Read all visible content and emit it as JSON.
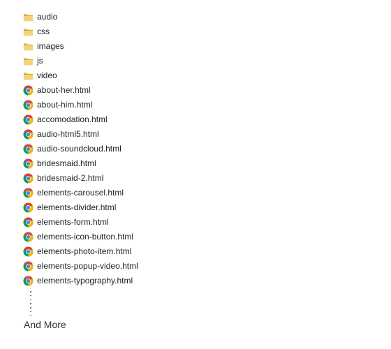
{
  "items": [
    {
      "name": "audio",
      "type": "folder",
      "icon": "folder-icon"
    },
    {
      "name": "css",
      "type": "folder",
      "icon": "folder-icon"
    },
    {
      "name": "images",
      "type": "folder",
      "icon": "folder-icon"
    },
    {
      "name": "js",
      "type": "folder",
      "icon": "folder-icon"
    },
    {
      "name": "video",
      "type": "folder",
      "icon": "folder-icon"
    },
    {
      "name": "about-her.html",
      "type": "html",
      "icon": "chrome-icon"
    },
    {
      "name": "about-him.html",
      "type": "html",
      "icon": "chrome-icon"
    },
    {
      "name": "accomodation.html",
      "type": "html",
      "icon": "chrome-icon"
    },
    {
      "name": "audio-html5.html",
      "type": "html",
      "icon": "chrome-icon"
    },
    {
      "name": "audio-soundcloud.html",
      "type": "html",
      "icon": "chrome-icon"
    },
    {
      "name": "bridesmaid.html",
      "type": "html",
      "icon": "chrome-icon"
    },
    {
      "name": "bridesmaid-2.html",
      "type": "html",
      "icon": "chrome-icon"
    },
    {
      "name": "elements-carousel.html",
      "type": "html",
      "icon": "chrome-icon"
    },
    {
      "name": "elements-divider.html",
      "type": "html",
      "icon": "chrome-icon"
    },
    {
      "name": "elements-form.html",
      "type": "html",
      "icon": "chrome-icon"
    },
    {
      "name": "elements-icon-button.html",
      "type": "html",
      "icon": "chrome-icon"
    },
    {
      "name": "elements-photo-item.html",
      "type": "html",
      "icon": "chrome-icon"
    },
    {
      "name": "elements-popup-video.html",
      "type": "html",
      "icon": "chrome-icon"
    },
    {
      "name": "elements-typography.html",
      "type": "html",
      "icon": "chrome-icon"
    }
  ],
  "footer": {
    "and_more": "And More"
  },
  "colors": {
    "folder_body": "#E8B84A",
    "folder_tab": "#F4D27A",
    "chrome_red": "#DB4437",
    "chrome_yellow": "#F4B400",
    "chrome_green": "#0F9D58",
    "chrome_blue": "#4285F4"
  }
}
